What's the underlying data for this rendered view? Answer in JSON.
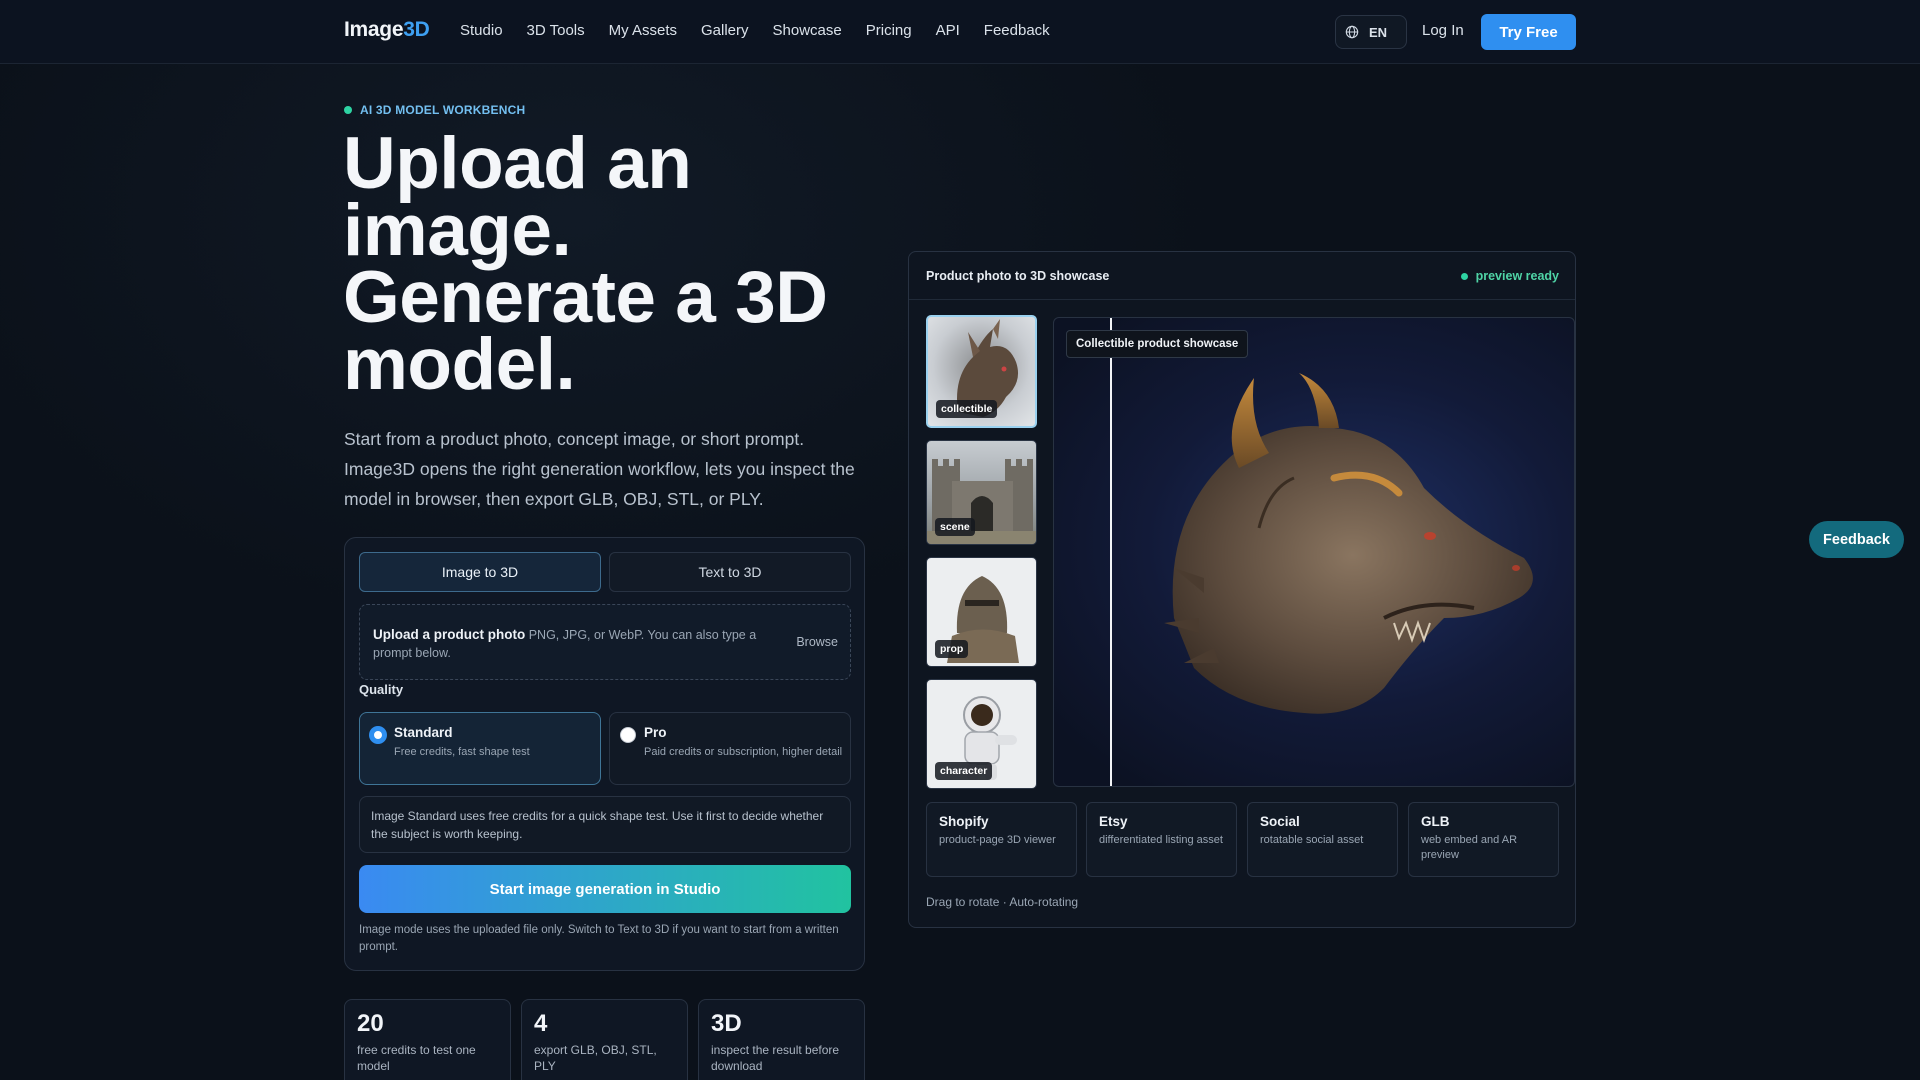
{
  "nav": {
    "logo_main": "Image",
    "logo_accent": "3D",
    "links": [
      "Studio",
      "3D Tools",
      "My Assets",
      "Gallery",
      "Showcase",
      "Pricing",
      "API",
      "Feedback"
    ],
    "lang": "EN",
    "login": "Log In",
    "cta": "Try Free"
  },
  "hero": {
    "eyebrow": "AI 3D MODEL WORKBENCH",
    "title": "Upload an image. Generate a 3D model.",
    "subtitle": "Start from a product photo, concept image, or short prompt. Image3D opens the right generation workflow, lets you inspect the model in browser, then export GLB, OBJ, STL, or PLY."
  },
  "generator": {
    "tabs": [
      "Image to 3D",
      "Text to 3D"
    ],
    "active_tab": "Image to 3D",
    "upload_title": "Upload a product photo",
    "upload_desc": "PNG, JPG, or WebP. You can also type a prompt below.",
    "browse": "Browse",
    "quality_label": "Quality",
    "quality_options": [
      {
        "title": "Standard",
        "desc": "Free credits, fast shape test",
        "selected": true
      },
      {
        "title": "Pro",
        "desc": "Paid credits or subscription, higher detail",
        "selected": false
      }
    ],
    "note": "Image Standard uses free credits for a quick shape test. Use it first to decide whether the subject is worth keeping.",
    "start_button": "Start image generation in Studio",
    "mode_note": "Image mode uses the uploaded file only. Switch to Text to 3D if you want to start from a written prompt."
  },
  "stats": [
    {
      "num": "20",
      "label": "free credits to test one model"
    },
    {
      "num": "4",
      "label": "export GLB, OBJ, STL, PLY"
    },
    {
      "num": "3D",
      "label": "inspect the result before download"
    }
  ],
  "showcase": {
    "title": "Product photo to 3D showcase",
    "status": "preview ready",
    "thumbnails": [
      "collectible",
      "scene",
      "prop",
      "character"
    ],
    "selected_thumbnail": "collectible",
    "viewer_label": "Collectible product showcase",
    "platforms": [
      {
        "title": "Shopify",
        "desc": "product-page 3D viewer"
      },
      {
        "title": "Etsy",
        "desc": "differentiated listing asset"
      },
      {
        "title": "Social",
        "desc": "rotatable social asset"
      },
      {
        "title": "GLB",
        "desc": "web embed and AR preview"
      }
    ],
    "hint": "Drag to rotate · Auto-rotating"
  },
  "floating_feedback": "Feedback",
  "colors": {
    "background": "#0b111a",
    "accent_blue": "#2f8ff0",
    "accent_green": "#2ed3a3",
    "gradient_start": "#3a8af2",
    "gradient_end": "#21c3a0"
  }
}
